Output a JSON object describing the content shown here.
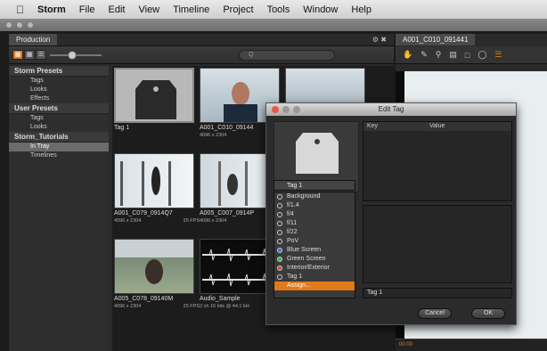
{
  "menu": {
    "app": "Storm",
    "items": [
      "File",
      "Edit",
      "View",
      "Timeline",
      "Project",
      "Tools",
      "Window",
      "Help"
    ]
  },
  "production": {
    "title": "Production",
    "search_placeholder": "Q"
  },
  "sidebar": {
    "sections": [
      {
        "label": "Storm Presets",
        "items": [
          "Tags",
          "Looks",
          "Effects"
        ]
      },
      {
        "label": "User Presets",
        "items": [
          "Tags",
          "Looks"
        ]
      },
      {
        "label": "Storm_Tutorials",
        "items": [
          "In Tray",
          "Timelines"
        ]
      }
    ]
  },
  "grid": {
    "items": [
      {
        "name": "Tag 1",
        "sub": "",
        "fps": ""
      },
      {
        "name": "A001_C010_09144",
        "sub": "4096 x 2304",
        "fps": ""
      },
      {
        "name": "A001_C079_0914Q7",
        "sub": "4096 x 2304",
        "fps": "25 FPS"
      },
      {
        "name": "A005_C007_0914P",
        "sub": "4096 x 2304",
        "fps": ""
      },
      {
        "name": "A005_C078_09140M",
        "sub": "4096 x 2304",
        "fps": "25 FPS"
      },
      {
        "name": "Audio_Sample",
        "sub": "2 ch 16 bits @ 44.1 kH",
        "fps": ""
      }
    ]
  },
  "viewer": {
    "title": "A001_C010_091441",
    "timecode": "00:00"
  },
  "dialog": {
    "title": "Edit Tag",
    "dropdown": "Tag 1",
    "list": [
      "Background",
      "f/1.4",
      "f/4",
      "f/11",
      "f/22",
      "PoV",
      "Blue Screen",
      "Green Screen",
      "Interior/Exterior",
      "Tag 1",
      "Assign..."
    ],
    "key_header": "Key",
    "value_header": "Value",
    "tag_name": "Tag 1",
    "cancel": "Cancel",
    "ok": "OK"
  }
}
